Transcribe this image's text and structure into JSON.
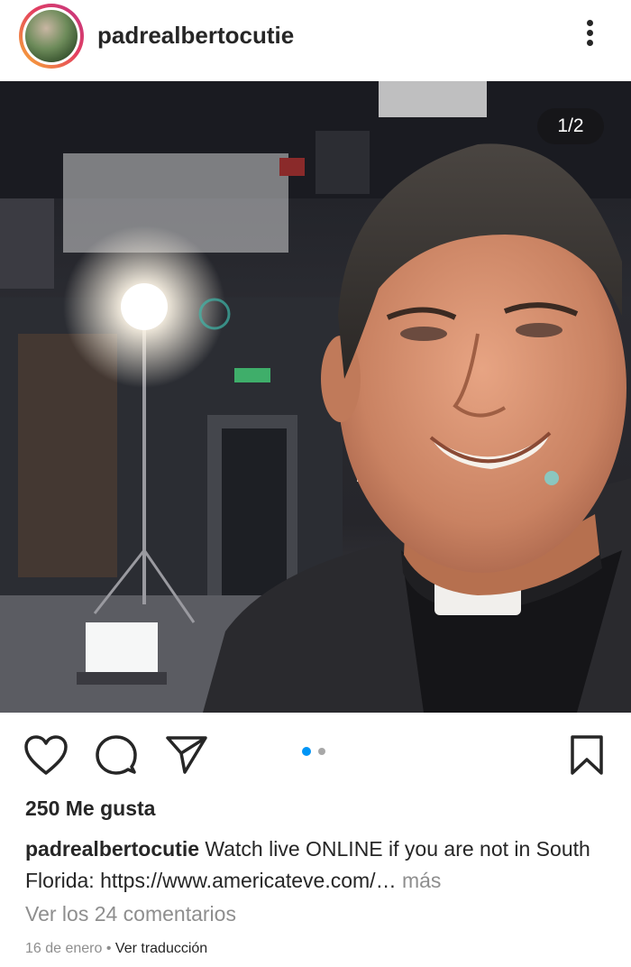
{
  "post": {
    "username": "padrealbertocutie",
    "image_counter": "1/2",
    "likes": "250 Me gusta",
    "caption_user": "padrealbertocutie",
    "caption_text": "Watch live ONLINE if you are not in South Florida: https://www.americateve.com/…",
    "caption_more": "más",
    "view_comments": "Ver los 24 comentarios",
    "date": "16 de enero",
    "separator": "•",
    "translate": "Ver traducción"
  },
  "icons": {
    "like": "heart-icon",
    "comment": "comment-icon",
    "share": "send-icon",
    "save": "bookmark-icon",
    "menu": "more-vertical-icon"
  },
  "colors": {
    "accent": "#0095f6",
    "inactive_dot": "#a8a8a8",
    "text": "#262626",
    "muted": "#8e8e8e"
  }
}
